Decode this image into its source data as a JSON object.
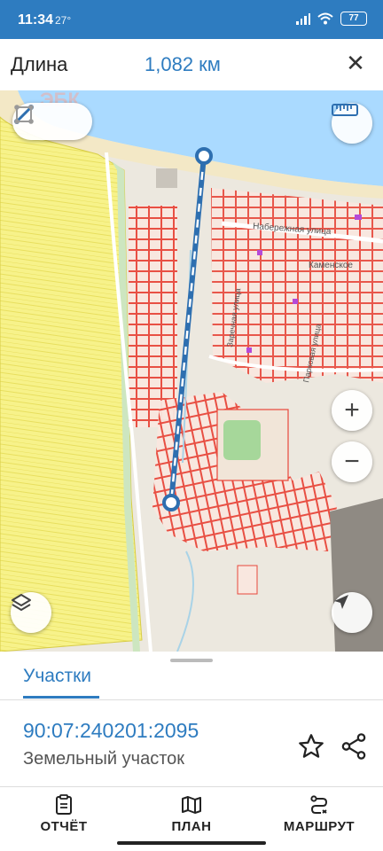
{
  "status_bar": {
    "time": "11:34",
    "temperature": "27°",
    "battery": "77"
  },
  "header": {
    "title": "Длина",
    "value": "1,082 км",
    "close_icon": "close-icon"
  },
  "map": {
    "watermark": "ЭБК",
    "labels": {
      "street": "Набережная улица",
      "village": "Каменское",
      "street2": "Парковая улица",
      "street3": "Заречная улица"
    },
    "colors": {
      "water": "#aadaff",
      "parcel_stroke": "#e8473b",
      "parcel_fill": "#f7e0d8",
      "farmland": "#f7f28a",
      "measure_line": "#2e6fb0"
    },
    "buttons": {
      "mode_line": "line-measure-icon",
      "mode_area": "area-measure-icon",
      "ruler": "ruler-icon",
      "zoom_in": "+",
      "zoom_out": "−",
      "layers": "layers-icon",
      "locate": "navigation-arrow-icon"
    }
  },
  "sheet": {
    "tab_label": "Участки",
    "parcel_id": "90:07:240201:2095",
    "parcel_type": "Земельный участок"
  },
  "bottom_nav": {
    "report": "ОТЧЁТ",
    "plan": "ПЛАН",
    "route": "МАРШРУТ"
  }
}
